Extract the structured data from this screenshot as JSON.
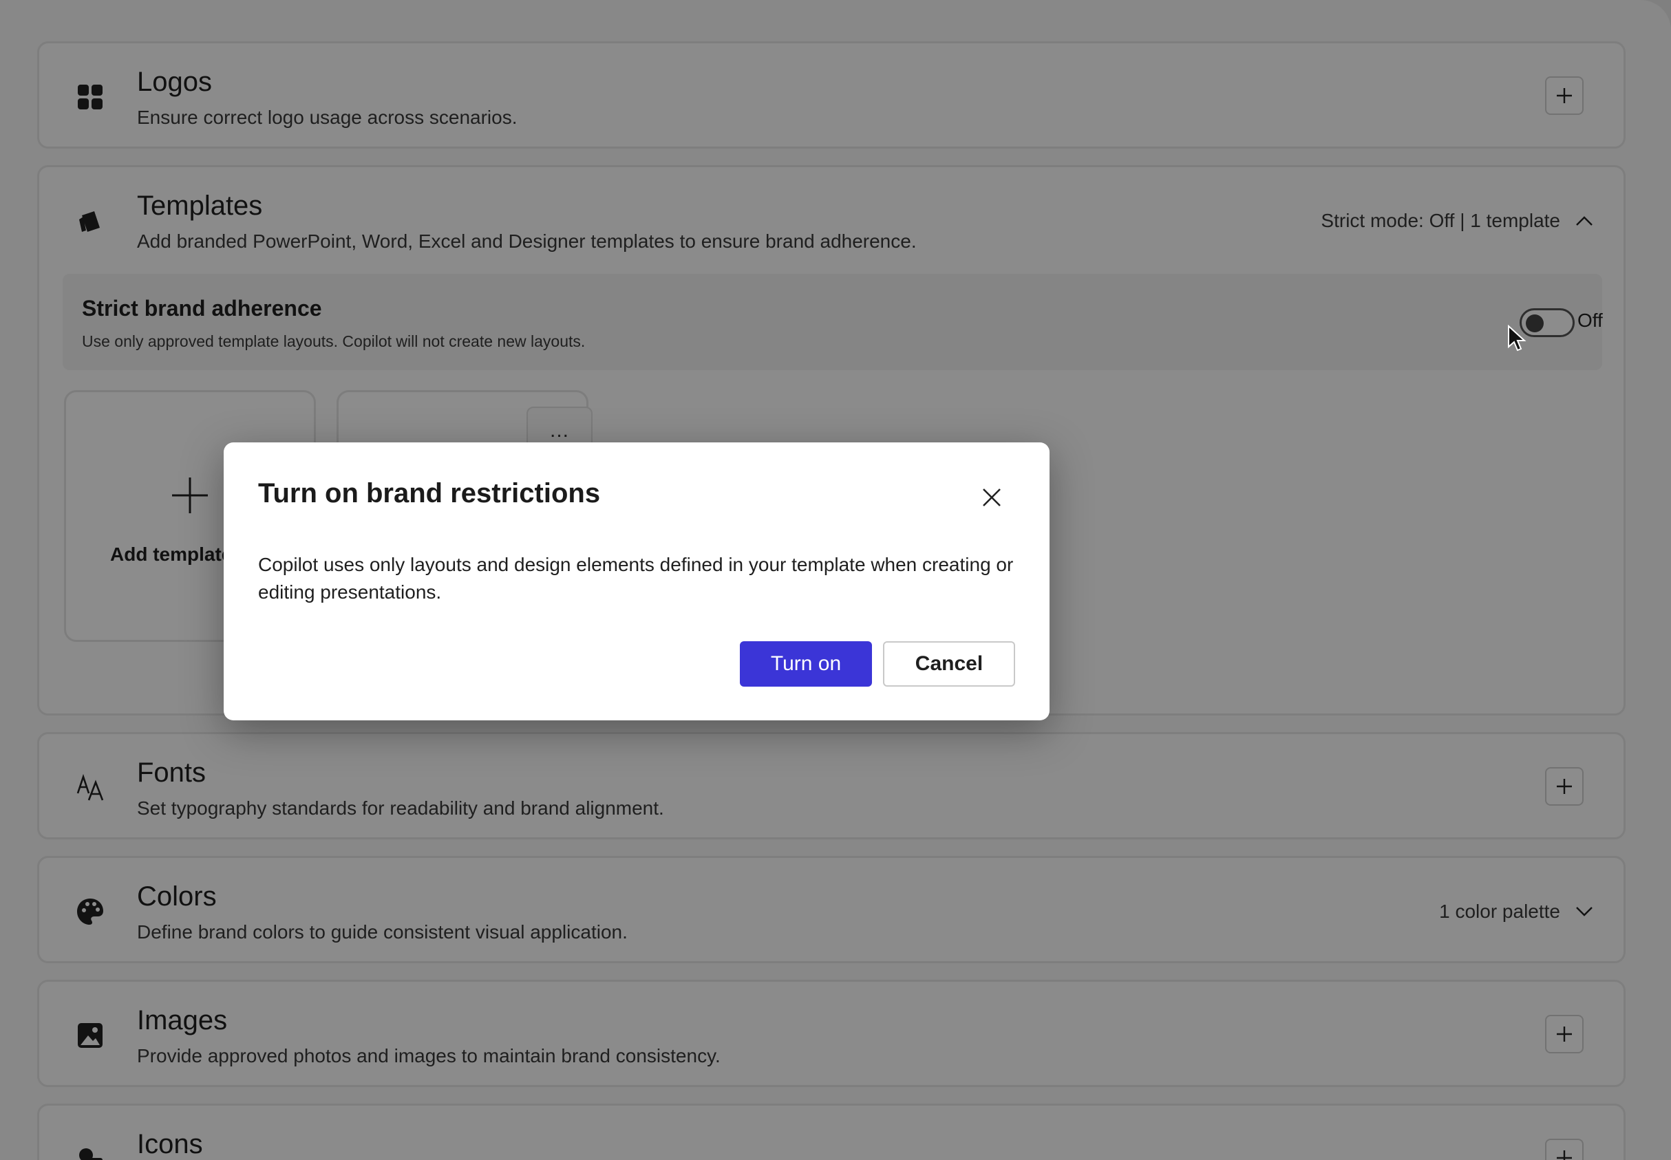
{
  "sections": {
    "logos": {
      "title": "Logos",
      "description": "Ensure correct logo usage across scenarios.",
      "icon": "grid-icon"
    },
    "templates": {
      "title": "Templates",
      "description": "Add branded PowerPoint, Word, Excel and Designer templates to ensure brand adherence.",
      "meta": "Strict mode: Off | 1 template",
      "icon": "template-icon",
      "strict": {
        "title": "Strict brand adherence",
        "description": "Use only approved template layouts. Copilot will not create new layouts.",
        "toggle_label": "Off"
      },
      "add_template_label": "Add template",
      "more_label": "..."
    },
    "fonts": {
      "title": "Fonts",
      "description": "Set typography standards for readability and brand alignment.",
      "icon": "font-icon"
    },
    "colors": {
      "title": "Colors",
      "description": "Define brand colors to guide consistent visual application.",
      "meta": "1 color palette",
      "icon": "palette-icon"
    },
    "images": {
      "title": "Images",
      "description": "Provide approved photos and images to maintain brand consistency.",
      "icon": "image-icon"
    },
    "icons": {
      "title": "Icons",
      "icon": "shapes-icon"
    }
  },
  "dialog": {
    "title": "Turn on brand restrictions",
    "body": "Copilot uses only layouts and design elements defined in your template when creating or editing presentations.",
    "confirm_label": "Turn on",
    "cancel_label": "Cancel"
  },
  "colors": {
    "primary": "#3b35d7",
    "overlay": "rgba(0,0,0,0.45)"
  }
}
